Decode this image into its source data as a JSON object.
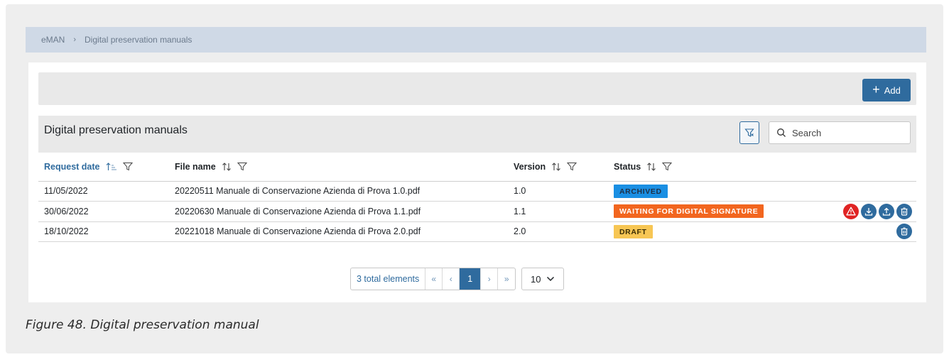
{
  "breadcrumb": {
    "root": "eMAN",
    "separator": "›",
    "current": "Digital preservation manuals"
  },
  "toolbar": {
    "add_label": "Add"
  },
  "table": {
    "title": "Digital preservation manuals",
    "search_placeholder": "Search",
    "columns": [
      {
        "label": "Request date",
        "sorted": "ascending"
      },
      {
        "label": "File name"
      },
      {
        "label": "Version"
      },
      {
        "label": "Status"
      }
    ],
    "rows": [
      {
        "date": "11/05/2022",
        "file": "20220511 Manuale di Conservazione Azienda di Prova 1.0.pdf",
        "version": "1.0",
        "status": "ARCHIVED",
        "actions": []
      },
      {
        "date": "30/06/2022",
        "file": "20220630 Manuale di Conservazione Azienda di Prova 1.1.pdf",
        "version": "1.1",
        "status": "WAITING FOR DIGITAL SIGNATURE",
        "actions": [
          "warning-icon",
          "download-icon",
          "upload-icon",
          "delete-icon"
        ]
      },
      {
        "date": "18/10/2022",
        "file": "20221018 Manuale di Conservazione Azienda di Prova 2.0.pdf",
        "version": "2.0",
        "status": "DRAFT",
        "actions": [
          "delete-icon"
        ]
      }
    ]
  },
  "pagination": {
    "total_label": "3 total elements",
    "first": "«",
    "prev": "‹",
    "current_page": "1",
    "next": "›",
    "last": "»",
    "page_size": "10"
  },
  "caption": "Figure 48. Digital preservation manual",
  "colors": {
    "accent": "#2f6b9e",
    "archived": "#1a8fe3",
    "waiting": "#f2661f",
    "draft": "#f7c654",
    "warning": "#e02424"
  }
}
